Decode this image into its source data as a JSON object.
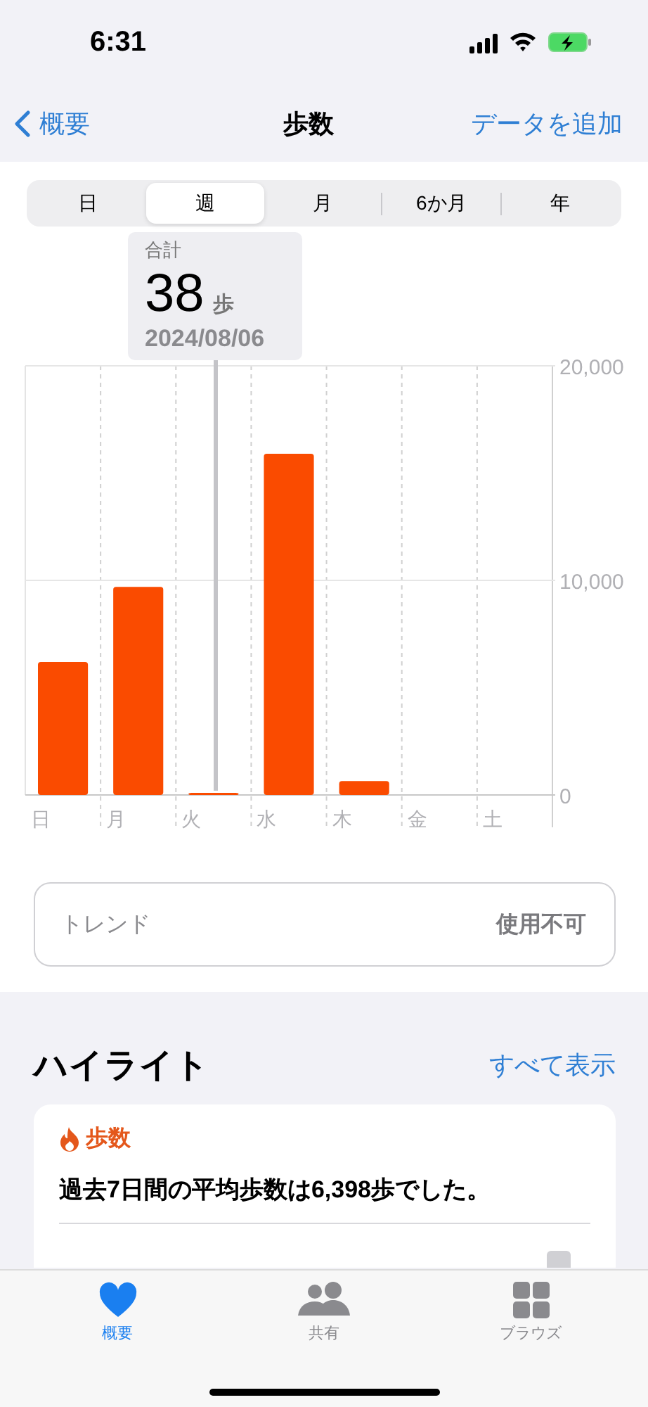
{
  "status_bar": {
    "time": "6:31"
  },
  "nav": {
    "back": "概要",
    "title": "歩数",
    "action": "データを追加"
  },
  "segments": [
    {
      "label": "日",
      "selected": false
    },
    {
      "label": "週",
      "selected": true
    },
    {
      "label": "月",
      "selected": false
    },
    {
      "label": "6か月",
      "selected": false
    },
    {
      "label": "年",
      "selected": false
    }
  ],
  "tooltip": {
    "label": "合計",
    "value": "38",
    "unit": "歩",
    "date": "2024/08/06"
  },
  "chart": {
    "chart_data": {
      "type": "bar",
      "categories": [
        "日",
        "月",
        "火",
        "水",
        "木",
        "金",
        "土"
      ],
      "values": [
        6200,
        9700,
        38,
        15900,
        650,
        null,
        null
      ],
      "ylim": [
        0,
        20000
      ],
      "yticks": [
        {
          "value": 0,
          "label": "0"
        },
        {
          "value": 10000,
          "label": "10,000"
        },
        {
          "value": 20000,
          "label": "20,000"
        }
      ]
    }
  },
  "trend": {
    "label": "トレンド",
    "value": "使用不可"
  },
  "highlights": {
    "title": "ハイライト",
    "action": "すべて表示",
    "card": {
      "title": "歩数",
      "text": "過去7日間の平均歩数は6,398歩でした。"
    }
  },
  "tab_bar": [
    {
      "label": "概要",
      "selected": true
    },
    {
      "label": "共有",
      "selected": false
    },
    {
      "label": "ブラウズ",
      "selected": false
    }
  ]
}
